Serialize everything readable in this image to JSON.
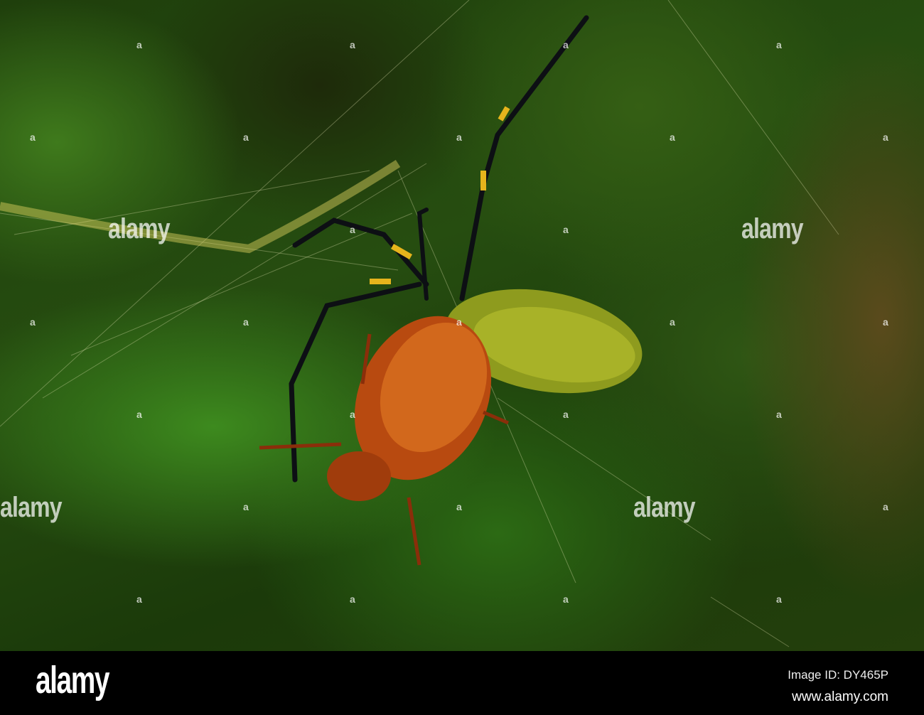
{
  "photo": {
    "subject": "spider-with-beetle-prey",
    "watermark_text": "alamy",
    "watermark_dot": "a"
  },
  "footer": {
    "logo": "alamy",
    "image_id": "Image ID: DY465P",
    "url": "www.alamy.com"
  }
}
